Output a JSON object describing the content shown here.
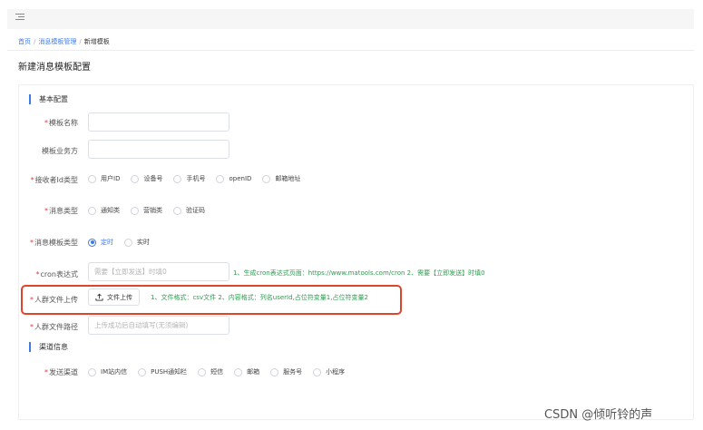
{
  "breadcrumb": {
    "home": "首页",
    "parent": "消息模板管理",
    "current": "新增模板",
    "sep": "/"
  },
  "page_title": "新建消息模板配置",
  "sections": {
    "basic": "基本配置",
    "channel": "渠道信息"
  },
  "form": {
    "template_name": {
      "label": "模板名称",
      "value": ""
    },
    "business": {
      "label": "模板业务方",
      "value": ""
    },
    "receiver_type": {
      "label": "接收者Id类型",
      "options": [
        "用户ID",
        "设备号",
        "手机号",
        "openID",
        "邮箱地址"
      ]
    },
    "message_type": {
      "label": "消息类型",
      "options": [
        "通知类",
        "营销类",
        "验证码"
      ]
    },
    "template_type": {
      "label": "消息模板类型",
      "options": [
        "定时",
        "实时"
      ],
      "selected": "定时"
    },
    "cron": {
      "label": "cron表达式",
      "placeholder": "需要【立即发送】时填0",
      "hint": "1、生成cron表达式页面：https://www.matools.com/cron 2、需要【立即发送】时填0"
    },
    "crowd_upload": {
      "label": "人群文件上传",
      "button": "文件上传",
      "hint": "1、文件格式：csv文件 2、内容格式：列名userId,占位符变量1,占位符变量2"
    },
    "crowd_path": {
      "label": "人群文件路径",
      "placeholder": "上传成功后自动填写(无须编辑)"
    },
    "send_channel": {
      "label": "发送渠道",
      "options": [
        "IM站内信",
        "PUSH通知栏",
        "短信",
        "邮箱",
        "服务号",
        "小程序"
      ]
    }
  },
  "watermark": "CSDN @倾听铃的声",
  "colors": {
    "accent": "#3f7be6",
    "required": "#e23b3b",
    "hint": "#2e9b4f",
    "highlight": "#e0452b"
  }
}
